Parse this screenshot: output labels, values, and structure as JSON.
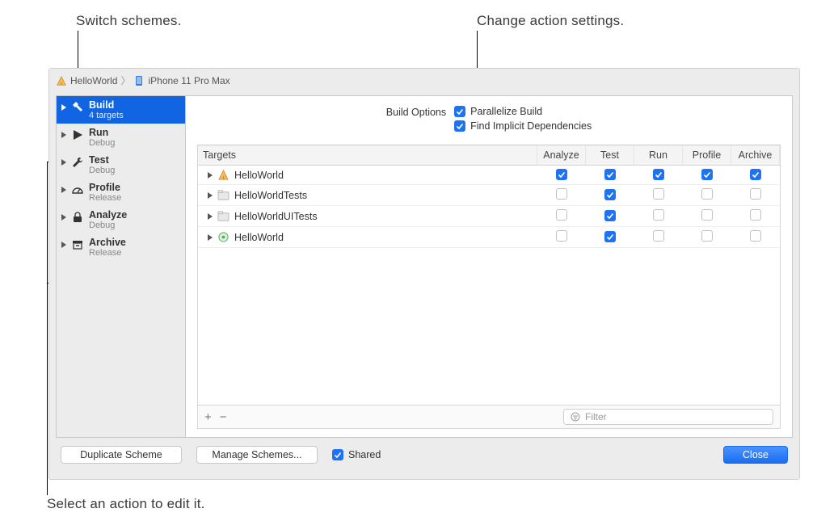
{
  "annotations": {
    "switch_schemes": "Switch schemes.",
    "change_action_settings": "Change action settings.",
    "select_action": "Select an action to edit it."
  },
  "breadcrumb": {
    "scheme": "HelloWorld",
    "device": "iPhone 11 Pro Max"
  },
  "sidebar": {
    "actions": [
      {
        "name": "Build",
        "sub": "4 targets",
        "icon": "hammer",
        "selected": true
      },
      {
        "name": "Run",
        "sub": "Debug",
        "icon": "play",
        "selected": false
      },
      {
        "name": "Test",
        "sub": "Debug",
        "icon": "wrench",
        "selected": false
      },
      {
        "name": "Profile",
        "sub": "Release",
        "icon": "gauge",
        "selected": false
      },
      {
        "name": "Analyze",
        "sub": "Debug",
        "icon": "lock",
        "selected": false
      },
      {
        "name": "Archive",
        "sub": "Release",
        "icon": "archive",
        "selected": false
      }
    ]
  },
  "build_options": {
    "label": "Build Options",
    "parallelize": {
      "label": "Parallelize Build",
      "checked": true
    },
    "implicit": {
      "label": "Find Implicit Dependencies",
      "checked": true
    }
  },
  "targets_table": {
    "columns": [
      "Targets",
      "Analyze",
      "Test",
      "Run",
      "Profile",
      "Archive"
    ],
    "rows": [
      {
        "name": "HelloWorld",
        "icon": "app",
        "checks": [
          true,
          true,
          true,
          true,
          true
        ]
      },
      {
        "name": "HelloWorldTests",
        "icon": "folder",
        "checks": [
          false,
          true,
          false,
          false,
          false
        ]
      },
      {
        "name": "HelloWorldUITests",
        "icon": "folder",
        "checks": [
          false,
          true,
          false,
          false,
          false
        ]
      },
      {
        "name": "HelloWorld",
        "icon": "pkg",
        "checks": [
          false,
          true,
          false,
          false,
          false
        ]
      }
    ]
  },
  "filter": {
    "placeholder": "Filter"
  },
  "buttons": {
    "duplicate": "Duplicate Scheme",
    "manage": "Manage Schemes...",
    "shared_label": "Shared",
    "shared_checked": true,
    "close": "Close",
    "plus": "+",
    "minus": "−"
  }
}
